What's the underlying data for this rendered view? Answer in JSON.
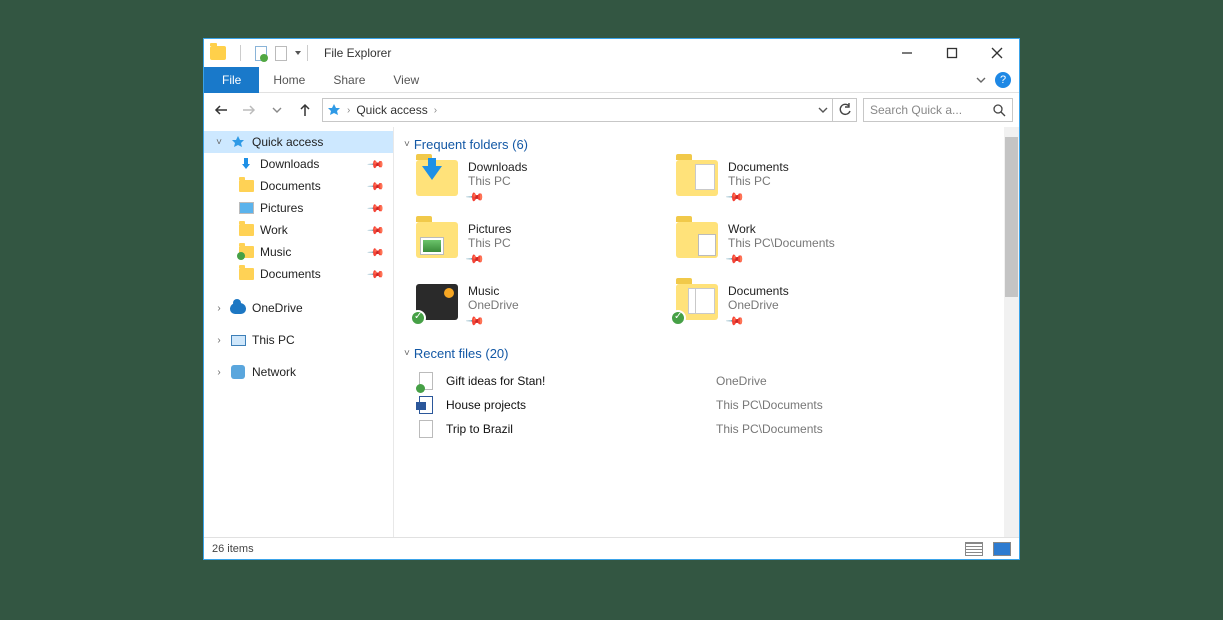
{
  "window": {
    "title": "File Explorer"
  },
  "ribbon": {
    "file": "File",
    "tabs": [
      "Home",
      "Share",
      "View"
    ]
  },
  "nav": {
    "breadcrumb": "Quick access",
    "search_placeholder": "Search Quick a..."
  },
  "sidebar": {
    "quick_access": {
      "label": "Quick access"
    },
    "pinned": [
      {
        "label": "Downloads",
        "icon": "download"
      },
      {
        "label": "Documents",
        "icon": "folder"
      },
      {
        "label": "Pictures",
        "icon": "pictures"
      },
      {
        "label": "Work",
        "icon": "folder"
      },
      {
        "label": "Music",
        "icon": "music"
      },
      {
        "label": "Documents",
        "icon": "folder"
      }
    ],
    "roots": [
      {
        "label": "OneDrive"
      },
      {
        "label": "This PC"
      },
      {
        "label": "Network"
      }
    ]
  },
  "sections": {
    "frequent": {
      "title": "Frequent folders (6)"
    },
    "recent": {
      "title": "Recent files (20)"
    }
  },
  "frequent": [
    {
      "name": "Downloads",
      "loc": "This PC",
      "variant": "download"
    },
    {
      "name": "Documents",
      "loc": "This PC",
      "variant": "docfolder"
    },
    {
      "name": "Pictures",
      "loc": "This PC",
      "variant": "picfolder"
    },
    {
      "name": "Work",
      "loc": "This PC\\Documents",
      "variant": "workfolder"
    },
    {
      "name": "Music",
      "loc": "OneDrive",
      "variant": "music",
      "sync": true
    },
    {
      "name": "Documents",
      "loc": "OneDrive",
      "variant": "plainfolder",
      "sync": true
    }
  ],
  "recent": [
    {
      "name": "Gift ideas for Stan!",
      "path": "OneDrive",
      "icon": "od"
    },
    {
      "name": "House projects",
      "path": "This PC\\Documents",
      "icon": "docx"
    },
    {
      "name": "Trip to Brazil",
      "path": "This PC\\Documents",
      "icon": "plain"
    }
  ],
  "status": {
    "count": "26 items"
  }
}
